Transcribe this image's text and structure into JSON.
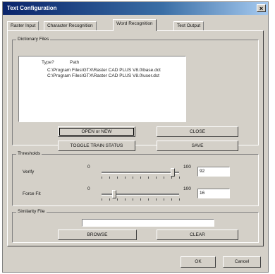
{
  "window": {
    "title": "Text Configuration",
    "close_glyph": "×"
  },
  "tabs": [
    {
      "label": "Raster Input"
    },
    {
      "label": "Character Recognition"
    },
    {
      "label": "Word Recognition",
      "active": true
    },
    {
      "label": "Text Output"
    }
  ],
  "dictionary": {
    "legend": "Dictionary Files",
    "columns": {
      "type": "Type?",
      "path": "Path"
    },
    "files": [
      "C:\\Program Files\\GTX\\Raster CAD PLUS V8.0\\base.dct",
      "C:\\Program Files\\GTX\\Raster CAD PLUS V8.0\\user.dct"
    ],
    "buttons": {
      "open_new": "OPEN or NEW",
      "close": "CLOSE",
      "toggle_train": "TOGGLE TRAIN STATUS",
      "save": "SAVE"
    }
  },
  "thresholds": {
    "legend": "Thresholds",
    "verify": {
      "label": "Verify",
      "min": "0",
      "max": "100",
      "value": "92",
      "level": 0.92
    },
    "force_fit": {
      "label": "Force Fit",
      "min": "0",
      "max": "100",
      "value": "16",
      "level": 0.16
    }
  },
  "similarity": {
    "legend": "Similarity File",
    "path": "",
    "browse": "BROWSE",
    "clear": "CLEAR"
  },
  "footer": {
    "ok": "OK",
    "cancel": "Cancel"
  }
}
